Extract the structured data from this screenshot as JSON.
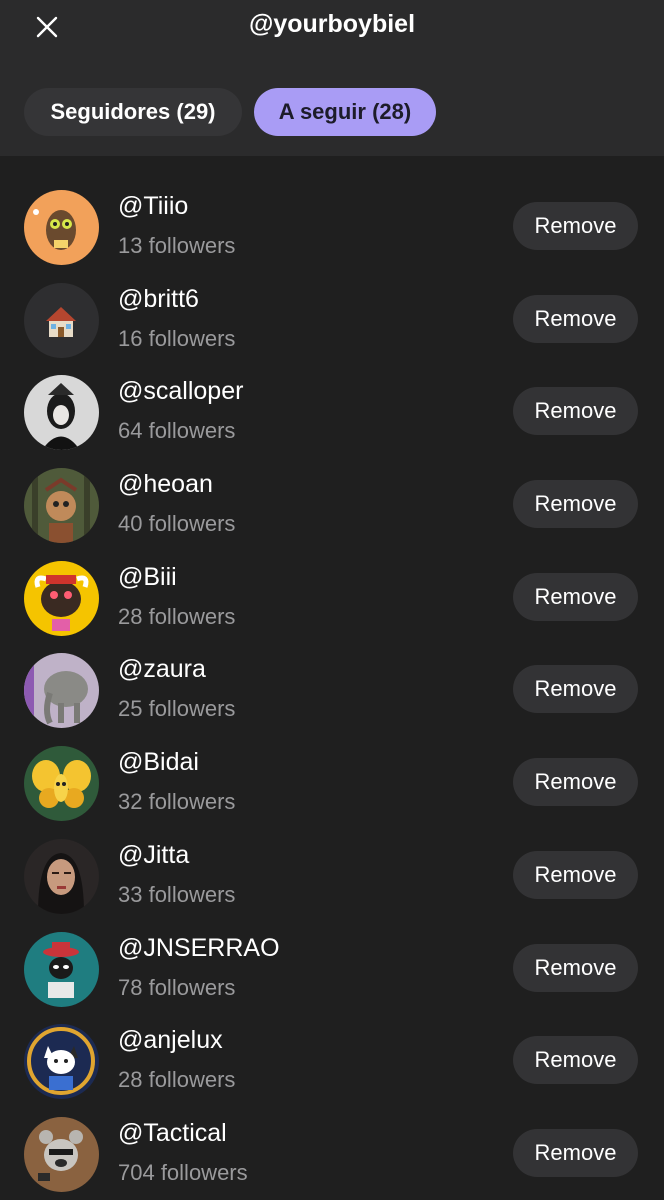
{
  "header": {
    "title": "@yourboybiel",
    "close_icon": "close-icon"
  },
  "tabs": [
    {
      "label": "Seguidores (29)",
      "active": false
    },
    {
      "label": "A seguir (28)",
      "active": true
    }
  ],
  "colors": {
    "background": "#1f1f1f",
    "header_background": "#2b2b2c",
    "accent": "#a99cf5",
    "muted_text": "#9a9a9c",
    "button_background": "#333335"
  },
  "users": [
    {
      "handle": "@Tiiio",
      "followers": "13 followers",
      "action": "Remove",
      "avatar": "tiiio-avatar"
    },
    {
      "handle": "@britt6",
      "followers": "16 followers",
      "action": "Remove",
      "avatar": "house-emoji-avatar"
    },
    {
      "handle": "@scalloper",
      "followers": "64 followers",
      "action": "Remove",
      "avatar": "scalloper-avatar"
    },
    {
      "handle": "@heoan",
      "followers": "40 followers",
      "action": "Remove",
      "avatar": "heoan-avatar"
    },
    {
      "handle": "@Biii",
      "followers": "28 followers",
      "action": "Remove",
      "avatar": "bull-avatar"
    },
    {
      "handle": "@zaura",
      "followers": "25 followers",
      "action": "Remove",
      "avatar": "elephant-avatar"
    },
    {
      "handle": "@Bidai",
      "followers": "32 followers",
      "action": "Remove",
      "avatar": "butterfly-avatar"
    },
    {
      "handle": "@Jitta",
      "followers": "33 followers",
      "action": "Remove",
      "avatar": "portrait-avatar"
    },
    {
      "handle": "@JNSERRAO",
      "followers": "78 followers",
      "action": "Remove",
      "avatar": "alien-cowboy-avatar"
    },
    {
      "handle": "@anjelux",
      "followers": "28 followers",
      "action": "Remove",
      "avatar": "cat-astronaut-avatar"
    },
    {
      "handle": "@Tactical",
      "followers": "704 followers",
      "action": "Remove",
      "avatar": "bear-avatar"
    }
  ]
}
